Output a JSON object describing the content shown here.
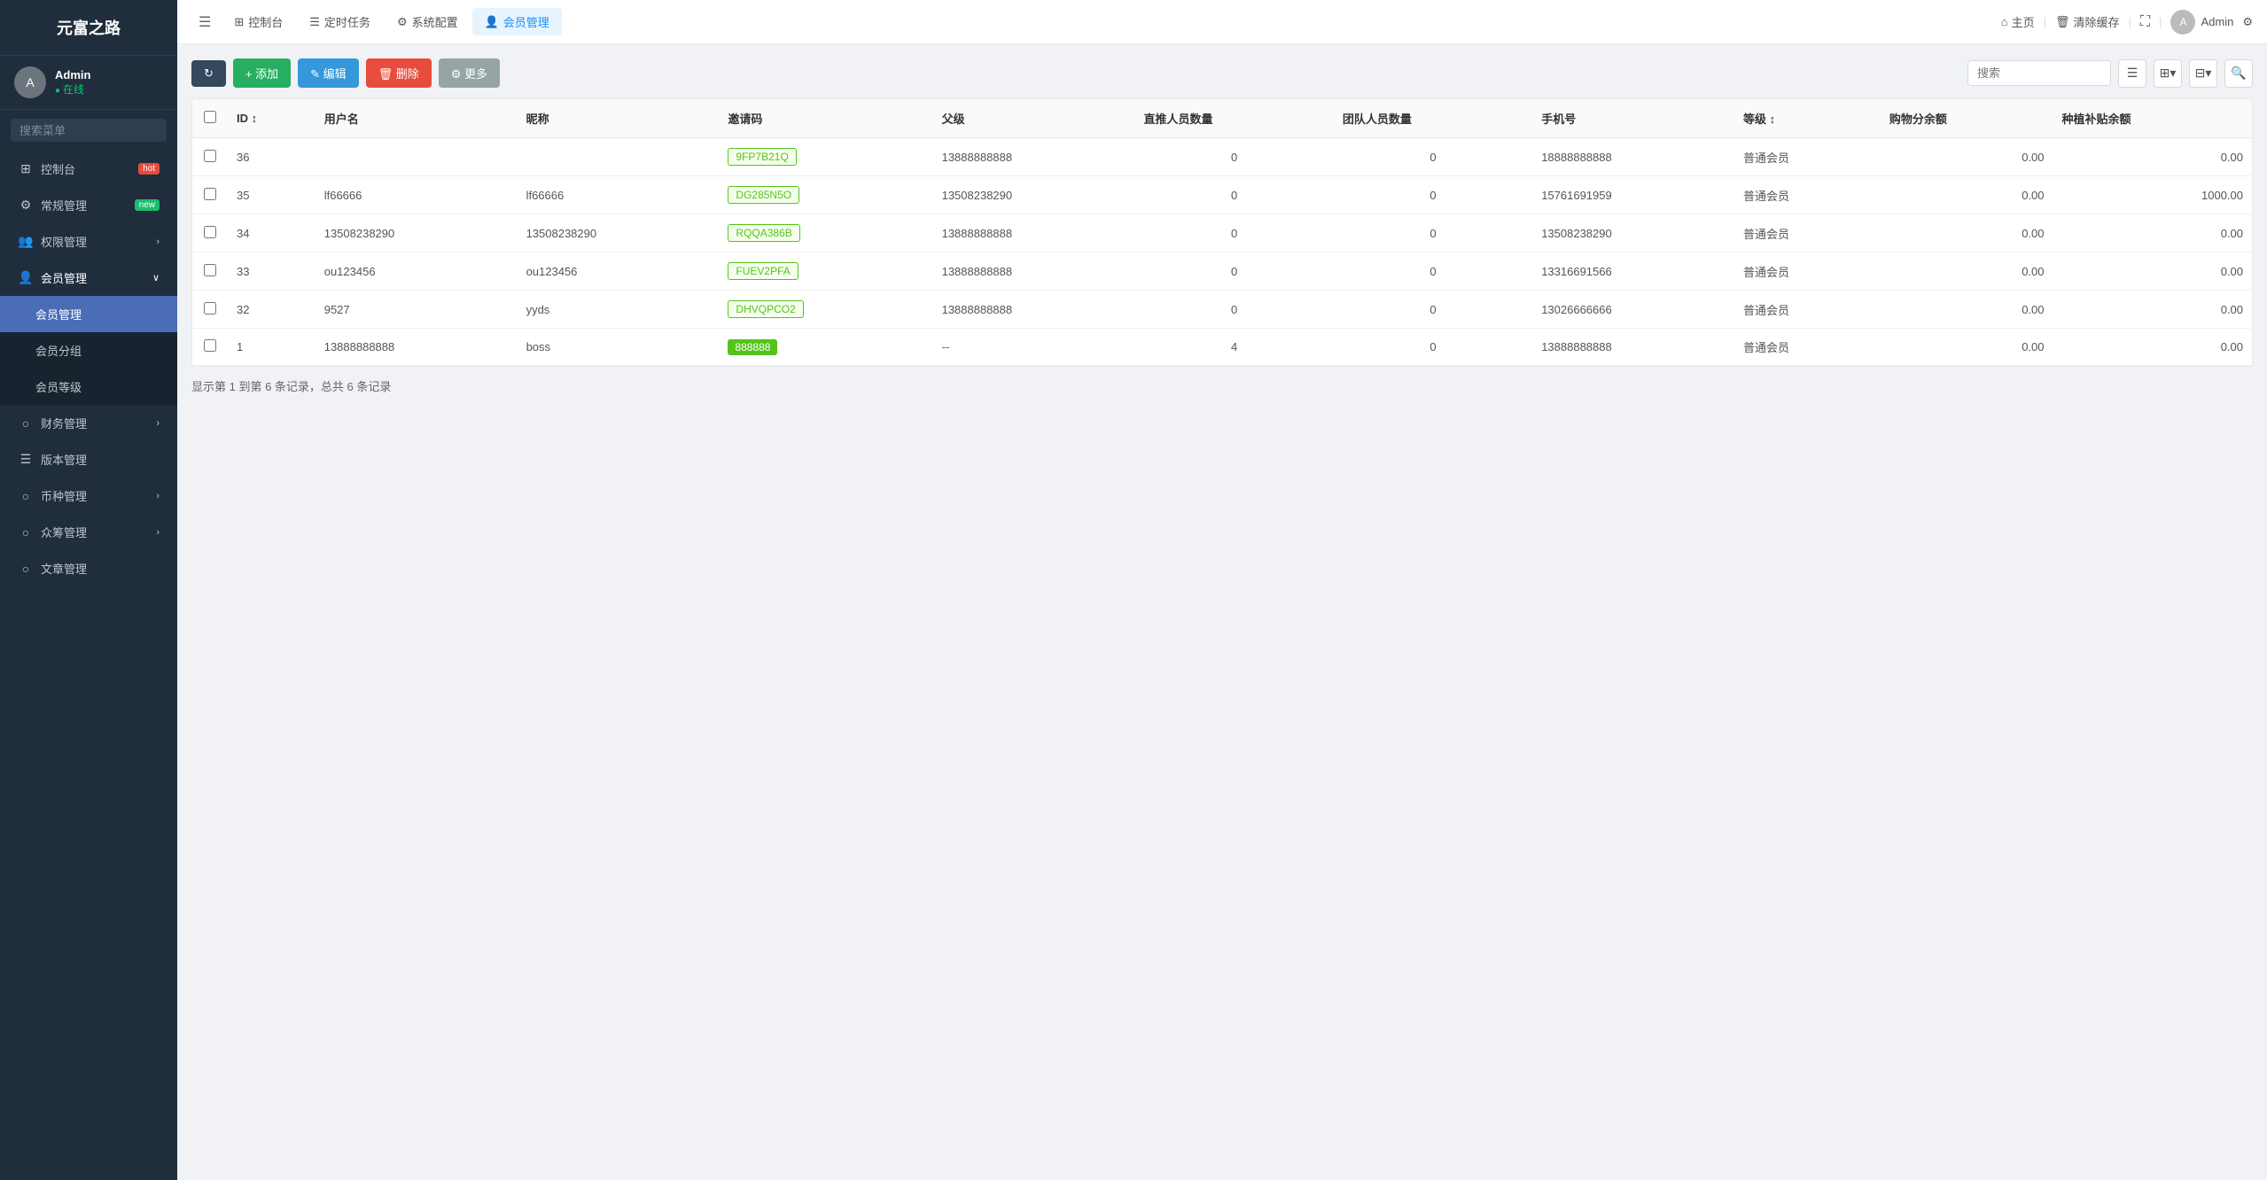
{
  "app": {
    "title": "元富之路"
  },
  "sidebar": {
    "user": {
      "name": "Admin",
      "status": "在线"
    },
    "search_placeholder": "搜索菜单",
    "items": [
      {
        "id": "dashboard",
        "icon": "⊞",
        "label": "控制台",
        "badge": "hot",
        "has_children": false
      },
      {
        "id": "general",
        "icon": "⚙",
        "label": "常规管理",
        "badge": "new",
        "has_children": false
      },
      {
        "id": "permissions",
        "icon": "👥",
        "label": "权限管理",
        "badge": "",
        "has_children": true
      },
      {
        "id": "members",
        "icon": "👤",
        "label": "会员管理",
        "badge": "",
        "has_children": true,
        "expanded": true
      },
      {
        "id": "member-mgmt",
        "icon": "",
        "label": "会员管理",
        "parent": "members",
        "active": true
      },
      {
        "id": "member-group",
        "icon": "",
        "label": "会员分组",
        "parent": "members"
      },
      {
        "id": "member-level",
        "icon": "",
        "label": "会员等级",
        "parent": "members"
      },
      {
        "id": "finance",
        "icon": "○",
        "label": "财务管理",
        "badge": "",
        "has_children": true
      },
      {
        "id": "version",
        "icon": "☰",
        "label": "版本管理",
        "badge": "",
        "has_children": false
      },
      {
        "id": "currency",
        "icon": "○",
        "label": "币种管理",
        "badge": "",
        "has_children": true
      },
      {
        "id": "crowdfunding",
        "icon": "○",
        "label": "众筹管理",
        "badge": "",
        "has_children": true
      },
      {
        "id": "article",
        "icon": "○",
        "label": "文章管理",
        "badge": "",
        "has_children": false
      }
    ]
  },
  "topnav": {
    "tabs": [
      {
        "id": "dashboard",
        "icon": "⊞",
        "label": "控制台"
      },
      {
        "id": "scheduled",
        "icon": "☰",
        "label": "定时任务"
      },
      {
        "id": "sysconfig",
        "icon": "⚙",
        "label": "系统配置"
      },
      {
        "id": "members",
        "icon": "👤",
        "label": "会员管理",
        "active": true
      }
    ],
    "right": {
      "home": "主页",
      "clear_cache": "清除缓存",
      "admin": "Admin"
    }
  },
  "toolbar": {
    "refresh_label": "↻",
    "add_label": "+ 添加",
    "edit_label": "✎ 编辑",
    "delete_label": "🗑 删除",
    "more_label": "⚙ 更多",
    "search_placeholder": "搜索"
  },
  "table": {
    "columns": [
      {
        "id": "id",
        "label": "ID",
        "sortable": true
      },
      {
        "id": "username",
        "label": "用户名"
      },
      {
        "id": "nickname",
        "label": "昵称"
      },
      {
        "id": "invite_code",
        "label": "邀请码"
      },
      {
        "id": "parent",
        "label": "父级"
      },
      {
        "id": "direct_count",
        "label": "直推人员数量"
      },
      {
        "id": "team_count",
        "label": "团队人员数量"
      },
      {
        "id": "phone",
        "label": "手机号"
      },
      {
        "id": "level",
        "label": "等级",
        "sortable": true
      },
      {
        "id": "shopping_balance",
        "label": "购物分余额"
      },
      {
        "id": "plant_balance",
        "label": "种植补贴余额"
      }
    ],
    "rows": [
      {
        "id": 36,
        "username": "",
        "nickname": "",
        "invite_code": "9FP7B21Q",
        "invite_style": "green-border",
        "parent": "13888888888",
        "direct_count": 0,
        "team_count": 0,
        "phone": "18888888888",
        "level": "普通会员",
        "shopping_balance": "0.00",
        "plant_balance": "0.00"
      },
      {
        "id": 35,
        "username": "lf66666",
        "nickname": "lf66666",
        "invite_code": "DG285N5O",
        "invite_style": "green-border",
        "parent": "13508238290",
        "direct_count": 0,
        "team_count": 0,
        "phone": "15761691959",
        "level": "普通会员",
        "shopping_balance": "0.00",
        "plant_balance": "1000.00"
      },
      {
        "id": 34,
        "username": "13508238290",
        "nickname": "13508238290",
        "invite_code": "RQQA386B",
        "invite_style": "green-border",
        "parent": "13888888888",
        "direct_count": 0,
        "team_count": 0,
        "phone": "13508238290",
        "level": "普通会员",
        "shopping_balance": "0.00",
        "plant_balance": "0.00"
      },
      {
        "id": 33,
        "username": "ou123456",
        "nickname": "ou123456",
        "invite_code": "FUEV2PFA",
        "invite_style": "green-border",
        "parent": "13888888888",
        "direct_count": 0,
        "team_count": 0,
        "phone": "13316691566",
        "level": "普通会员",
        "shopping_balance": "0.00",
        "plant_balance": "0.00"
      },
      {
        "id": 32,
        "username": "9527",
        "nickname": "yyds",
        "invite_code": "DHVQPCO2",
        "invite_style": "green-border",
        "parent": "13888888888",
        "direct_count": 0,
        "team_count": 0,
        "phone": "13026666666",
        "level": "普通会员",
        "shopping_balance": "0.00",
        "plant_balance": "0.00"
      },
      {
        "id": 1,
        "username": "13888888888",
        "nickname": "boss",
        "invite_code": "888888",
        "invite_style": "green-fill",
        "parent": "--",
        "direct_count": 4,
        "team_count": 0,
        "phone": "13888888888",
        "level": "普通会员",
        "shopping_balance": "0.00",
        "plant_balance": "0.00"
      }
    ]
  },
  "pagination": {
    "info": "显示第 1 到第 6 条记录，总共 6 条记录"
  }
}
